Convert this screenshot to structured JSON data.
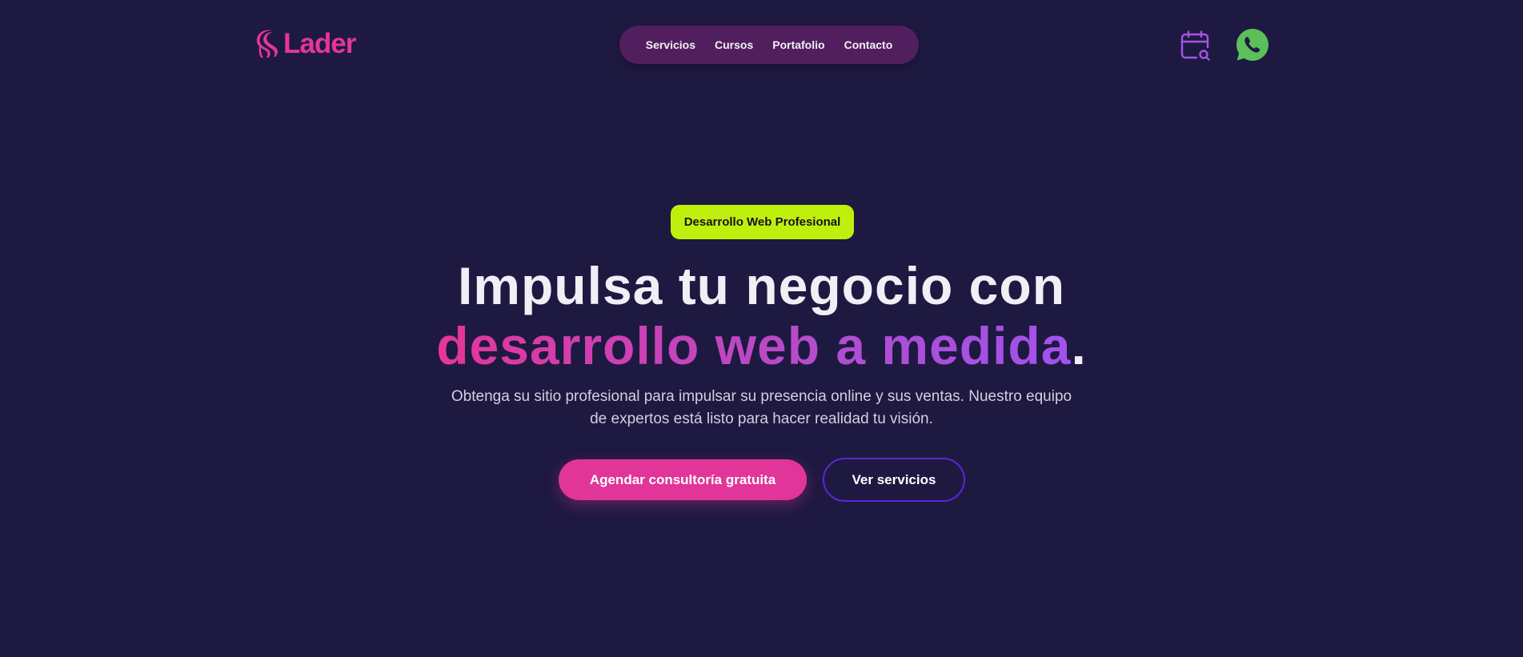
{
  "header": {
    "logo_text": "Lader",
    "logo_icon": "lader-hair-logo-icon",
    "nav": [
      {
        "label": "Servicios"
      },
      {
        "label": "Cursos"
      },
      {
        "label": "Portafolio"
      },
      {
        "label": "Contacto"
      }
    ],
    "actions": {
      "calendar_icon": "calendar-search-icon",
      "whatsapp_icon": "whatsapp-icon"
    }
  },
  "hero": {
    "badge": "Desarrollo Web Profesional",
    "headline_line1": "Impulsa tu negocio con",
    "headline_highlight": "desarrollo web a medida",
    "headline_period": ".",
    "subtitle": "Obtenga su sitio profesional para impulsar su presencia online y sus ventas. Nuestro equipo de expertos está listo para hacer realidad tu visión.",
    "primary_cta": "Agendar consultoría gratuita",
    "secondary_cta": "Ver servicios"
  },
  "colors": {
    "background": "#1e1941",
    "brand_pink": "#e6359a",
    "nav_pill": "#521f5e",
    "badge_lime": "#bff00d",
    "gradient_purple": "#a052ee",
    "outline_purple": "#5f24d6",
    "whatsapp_green": "#5bbf5a"
  }
}
